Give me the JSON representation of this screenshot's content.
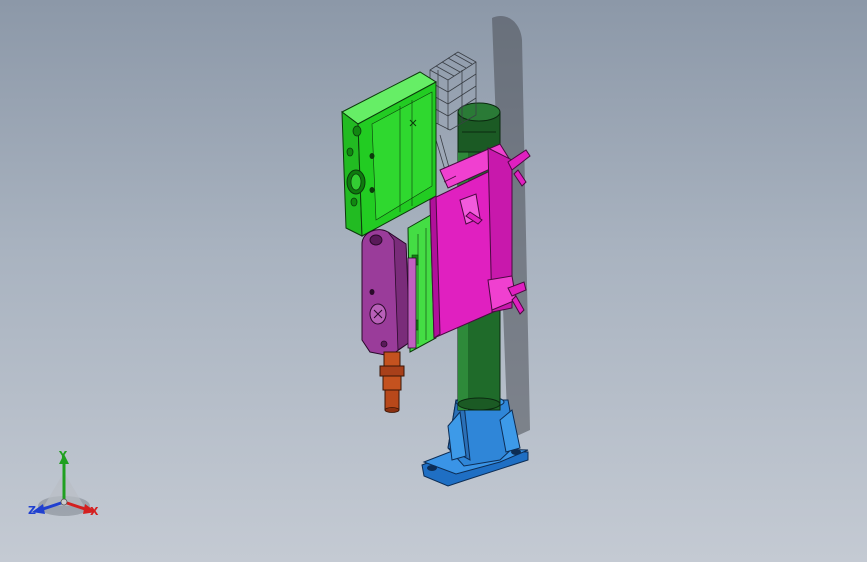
{
  "viewport": {
    "background_top": "#8c98a8",
    "background_bottom": "#c4cad3"
  },
  "model": {
    "parts": [
      {
        "name": "base-plate",
        "color": "#2f86d8"
      },
      {
        "name": "column",
        "color": "#1f6b2a"
      },
      {
        "name": "column-cap",
        "color": "#1b5a24"
      },
      {
        "name": "clamp-bracket",
        "color": "#e020c0"
      },
      {
        "name": "gear-housing",
        "color": "#22cc22"
      },
      {
        "name": "slide-plate",
        "color": "#44dd44"
      },
      {
        "name": "tool-holder",
        "color": "#9a3c9a"
      },
      {
        "name": "spindle-tip",
        "color": "#b8481a"
      },
      {
        "name": "wireframe-cage",
        "color": "#3a3f46"
      }
    ]
  },
  "triad": {
    "x_label": "X",
    "y_label": "Y",
    "z_label": "Z",
    "x_color": "#d42020",
    "y_color": "#20a020",
    "z_color": "#2040d0"
  }
}
